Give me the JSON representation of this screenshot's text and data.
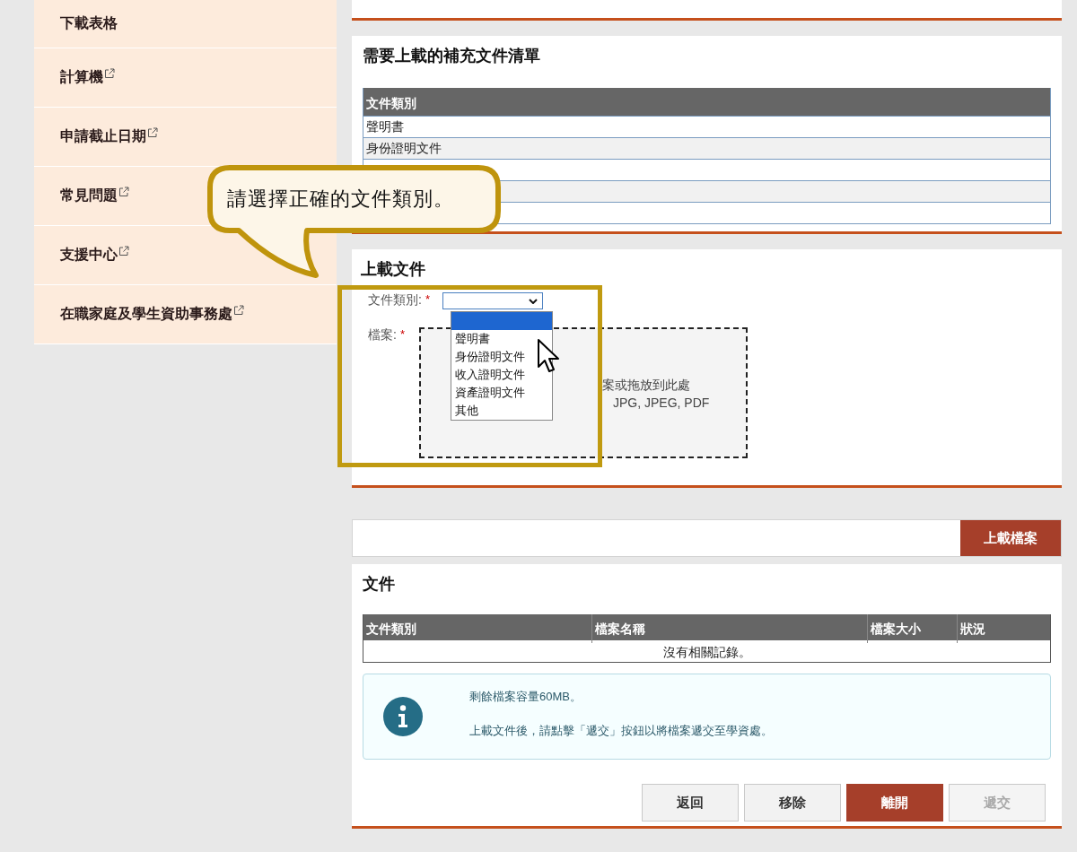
{
  "sidebar": {
    "items": [
      {
        "label": "下載表格",
        "external": false
      },
      {
        "label": "計算機",
        "external": true
      },
      {
        "label": "申請截止日期",
        "external": true
      },
      {
        "label": "常見問題",
        "external": true
      },
      {
        "label": "支援中心",
        "external": true
      },
      {
        "label": "在職家庭及學生資助事務處",
        "external": true
      }
    ]
  },
  "required_docs": {
    "title": "需要上載的補充文件清單",
    "column": "文件類別",
    "rows": [
      "聲明書",
      "身份證明文件"
    ]
  },
  "callout": {
    "text": "請選擇正確的文件類別。"
  },
  "upload": {
    "title": "上載文件",
    "type_label": "文件類別:",
    "file_label": "檔案:",
    "required_mark": "*",
    "dropdown": {
      "expanded": true,
      "blank_highlighted": true,
      "options": [
        "聲明書",
        "身份證明文件",
        "收入證明文件",
        "資產證明文件",
        "其他"
      ]
    },
    "drop_hint": [
      "案或拖放到此處",
      "JPG, JPEG, PDF"
    ]
  },
  "upload_button": "上載檔案",
  "documents": {
    "title": "文件",
    "columns": [
      "文件類別",
      "檔案名稱",
      "檔案大小",
      "狀況"
    ],
    "empty_text": "沒有相關記錄。"
  },
  "info": [
    "剩餘檔案容量60MB。",
    "上載文件後，請點擊「遞交」按鈕以將檔案遞交至學資處。"
  ],
  "buttons": [
    {
      "label": "返回",
      "kind": "default",
      "disabled": false
    },
    {
      "label": "移除",
      "kind": "default",
      "disabled": false
    },
    {
      "label": "離開",
      "kind": "primary",
      "disabled": false
    },
    {
      "label": "遞交",
      "kind": "default",
      "disabled": true
    }
  ]
}
